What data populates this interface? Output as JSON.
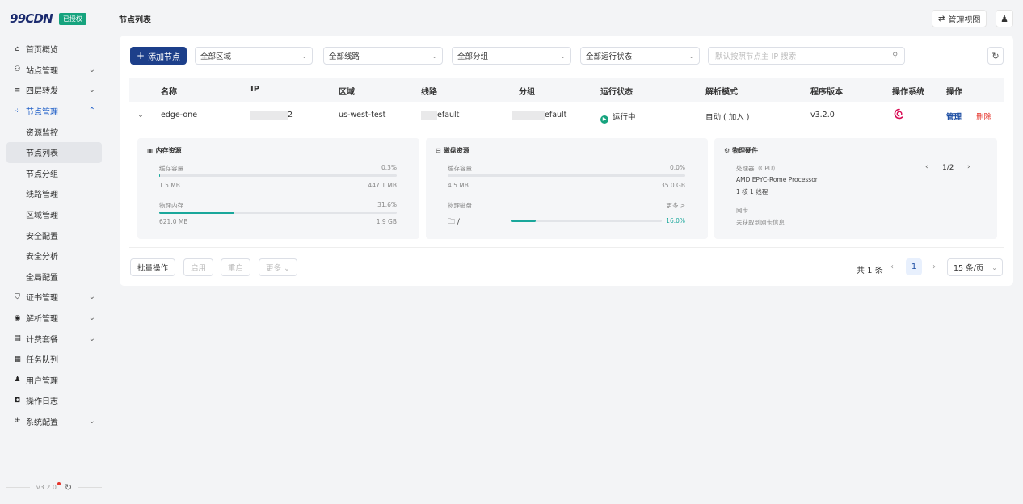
{
  "brand": {
    "logo": "99CDN",
    "badge": "已授权"
  },
  "sidebar": {
    "items": [
      {
        "label": "首页概览",
        "icon": "home-icon",
        "glyph": "⌂"
      },
      {
        "label": "站点管理",
        "icon": "sitemap-icon",
        "glyph": "⚇",
        "chevron": "⌄"
      },
      {
        "label": "四层转发",
        "icon": "server-icon",
        "glyph": "≡",
        "chevron": "⌄"
      },
      {
        "label": "节点管理",
        "icon": "nodes-icon",
        "glyph": "⁘",
        "chevron": "⌃"
      },
      {
        "label": "资源监控"
      },
      {
        "label": "节点列表"
      },
      {
        "label": "节点分组"
      },
      {
        "label": "线路管理"
      },
      {
        "label": "区域管理"
      },
      {
        "label": "安全配置"
      },
      {
        "label": "安全分析"
      },
      {
        "label": "全局配置"
      },
      {
        "label": "证书管理",
        "icon": "shield-icon",
        "glyph": "⛉",
        "chevron": "⌄"
      },
      {
        "label": "解析管理",
        "icon": "dns-icon",
        "glyph": "◉",
        "chevron": "⌄"
      },
      {
        "label": "计费套餐",
        "icon": "bill-icon",
        "glyph": "▤",
        "chevron": "⌄"
      },
      {
        "label": "任务队列",
        "icon": "task-icon",
        "glyph": "▦"
      },
      {
        "label": "用户管理",
        "icon": "user-icon",
        "glyph": "♟"
      },
      {
        "label": "操作日志",
        "icon": "log-icon",
        "glyph": "◘"
      },
      {
        "label": "系统配置",
        "icon": "system-icon",
        "glyph": "⁜",
        "chevron": "⌄"
      }
    ],
    "version": "v3.2.0"
  },
  "header": {
    "title": "节点列表",
    "view_switch": "管理视图"
  },
  "toolbar": {
    "add_node": "添加节点",
    "region": "全部区域",
    "line": "全部线路",
    "group": "全部分组",
    "status": "全部运行状态",
    "search_placeholder": "默认按照节点主 IP 搜索"
  },
  "table": {
    "columns": [
      "名称",
      "IP",
      "区域",
      "线路",
      "分组",
      "运行状态",
      "解析模式",
      "程序版本",
      "操作系统",
      "操作"
    ],
    "row": {
      "name": "edge-one",
      "ip": "2",
      "region": "us-west-test",
      "line": "efault",
      "group": "efault",
      "status": "运行中",
      "dns_mode": "自动 ( 加入 )",
      "version": "v3.2.0",
      "os_icon": "debian-icon",
      "manage": "管理",
      "delete": "删除"
    }
  },
  "memory": {
    "title": "内存资源",
    "cache_label": "缓存容量",
    "cache_pct": "0.3%",
    "cache_pct_value": 0.3,
    "cache_used": "1.5 MB",
    "cache_total": "447.1 MB",
    "phys_label": "物理内存",
    "phys_pct": "31.6%",
    "phys_pct_value": 31.6,
    "phys_used": "621.0 MB",
    "phys_total": "1.9 GB"
  },
  "disk": {
    "title": "磁盘资源",
    "cache_label": "缓存容量",
    "cache_pct": "0.0%",
    "cache_pct_value": 0.0,
    "cache_used": "4.5 MB",
    "cache_total": "35.0 GB",
    "phys_label": "物理磁盘",
    "more": "更多 >",
    "mount": "/",
    "mount_pct": "16.0%",
    "mount_pct_value": 16.0
  },
  "hardware": {
    "title": "物理硬件",
    "cpu_label": "处理器（CPU）",
    "cpu_model": "AMD EPYC-Rome Processor",
    "cpu_cores": "1 核   1 线程",
    "nic_label": "网卡",
    "nic_value": "未获取到网卡信息",
    "pager": "1/2"
  },
  "footer": {
    "batch": "批量操作",
    "enable": "启用",
    "restart": "重启",
    "more": "更多 ⌄",
    "total": "共 1 条",
    "page": "1",
    "page_size": "15 条/页"
  },
  "colors": {
    "primary": "#1d3f8a",
    "success": "#16a37e",
    "danger": "#e5342b",
    "bar": "#1aa79b"
  }
}
